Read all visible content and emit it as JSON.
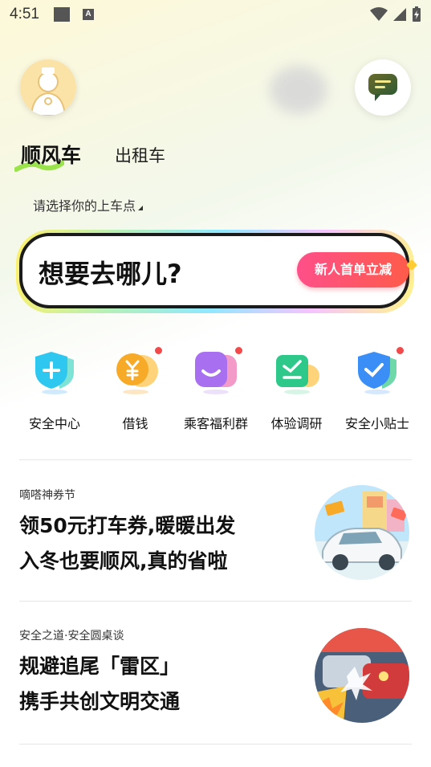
{
  "status_bar": {
    "time": "4:51",
    "notification_icon": "A"
  },
  "header": {
    "avatar_icon": "user-avatar",
    "message_icon": "chat-bubble"
  },
  "tabs": [
    {
      "label": "顺风车",
      "active": true
    },
    {
      "label": "出租车",
      "active": false
    }
  ],
  "pickup": {
    "label": "请选择你的上车点"
  },
  "search": {
    "placeholder": "想要去哪儿?",
    "promo": "新人首单立减"
  },
  "services": [
    {
      "label": "安全中心",
      "badge": false,
      "color": "#2ec7f0"
    },
    {
      "label": "借钱",
      "badge": true,
      "color": "#f7a928"
    },
    {
      "label": "乘客福利群",
      "badge": true,
      "color": "#a86ff0"
    },
    {
      "label": "体验调研",
      "badge": false,
      "color": "#2ec98a"
    },
    {
      "label": "安全小贴士",
      "badge": true,
      "color": "#3a8ef6"
    }
  ],
  "articles": [
    {
      "tag": "嘀嗒神券节",
      "line1": "领50元打车券,暖暖出发",
      "line2": "入冬也要顺风,真的省啦"
    },
    {
      "tag": "安全之道·安全圆桌谈",
      "line1": "规避追尾「雷区」",
      "line2": "携手共创文明交通"
    }
  ],
  "colors": {
    "accent_yellow": "#fff06a",
    "promo_red": "#ff4f6a",
    "badge_red": "#f24a4a"
  }
}
